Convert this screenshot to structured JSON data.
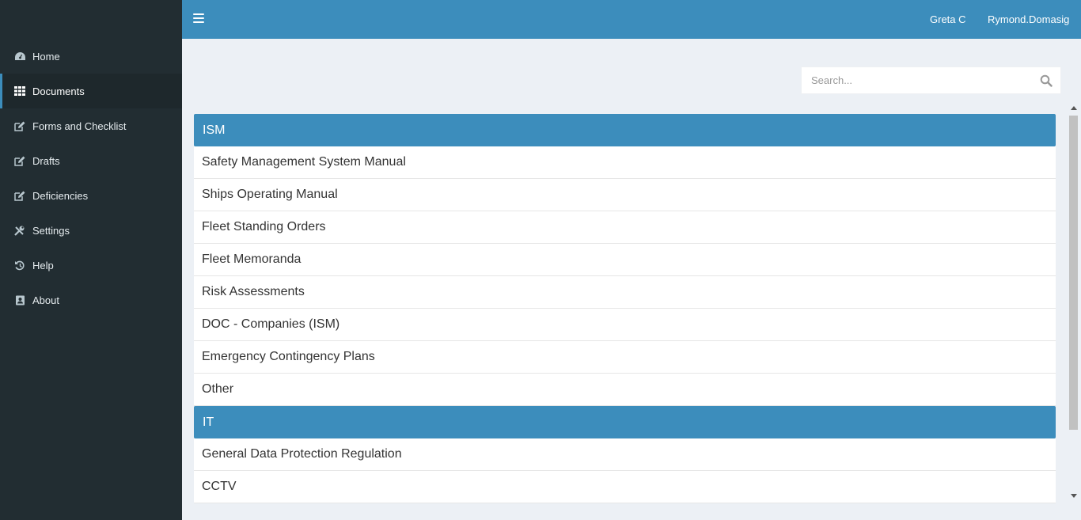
{
  "header": {
    "user_vessel": "Greta C",
    "user_name": "Rymond.Domasig"
  },
  "sidebar": {
    "items": [
      {
        "label": "Home",
        "icon": "dashboard-icon"
      },
      {
        "label": "Documents",
        "icon": "grid-icon",
        "active": true
      },
      {
        "label": "Forms and Checklist",
        "icon": "edit-icon"
      },
      {
        "label": "Drafts",
        "icon": "edit-icon"
      },
      {
        "label": "Deficiencies",
        "icon": "edit-icon"
      },
      {
        "label": "Settings",
        "icon": "wrench-icon"
      },
      {
        "label": "Help",
        "icon": "history-icon"
      },
      {
        "label": "About",
        "icon": "contact-book-icon"
      }
    ]
  },
  "search": {
    "placeholder": "Search...",
    "value": ""
  },
  "groups": [
    {
      "title": "ISM",
      "items": [
        "Safety Management System Manual",
        "Ships Operating Manual",
        "Fleet Standing Orders",
        "Fleet Memoranda",
        "Risk Assessments",
        "DOC - Companies (ISM)",
        "Emergency Contingency Plans",
        "Other"
      ]
    },
    {
      "title": "IT",
      "items": [
        "General Data Protection Regulation",
        "CCTV"
      ]
    }
  ],
  "colors": {
    "accent": "#3c8dbc",
    "sidebar_bg": "#222d32",
    "content_bg": "#ecf0f5"
  }
}
